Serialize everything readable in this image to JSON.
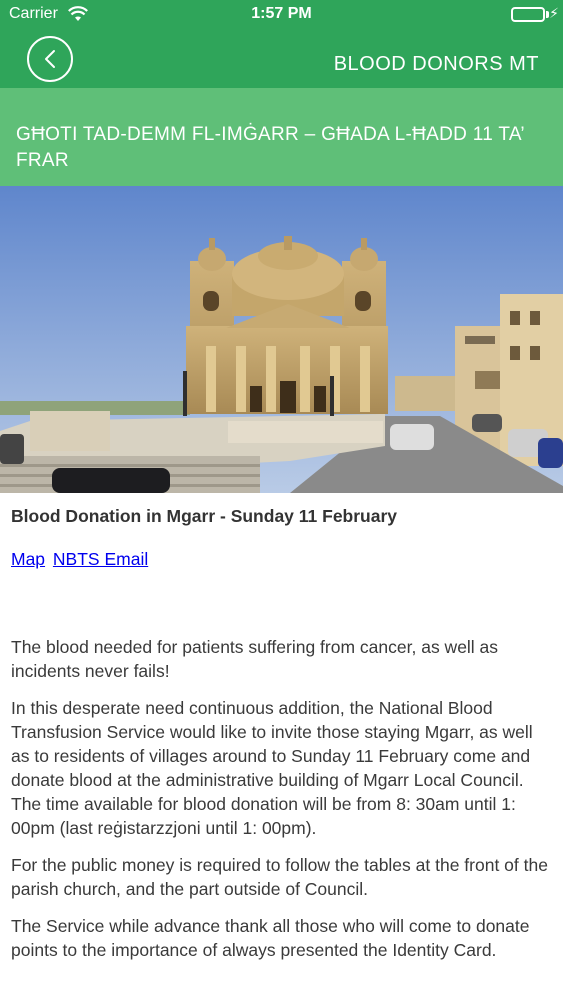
{
  "status_bar": {
    "carrier": "Carrier",
    "time": "1:57 PM",
    "battery_level": 1.0
  },
  "nav": {
    "back_icon": "chevron-left-icon",
    "title": "BLOOD DONORS MT"
  },
  "article": {
    "title": "GĦOTI TAD-DEMM FL-IMĠARR – GĦADA L-ĦADD 11 TA’ FRAR",
    "image_subject": "church",
    "headline": "Blood Donation in Mgarr - Sunday 11 February",
    "links": [
      "Map",
      "NBTS Email"
    ],
    "paragraphs": [
      "The blood needed for patients suffering from cancer, as well as incidents never fails!",
      "In this desperate need continuous addition, the National Blood Transfusion Service would like to invite those staying Mgarr, as well as to residents of villages around to Sunday 11 February come and donate blood at the administrative building of Mgarr Local Council. The time available for blood donation will be from 8: 30am until 1: 00pm (last reġistarzzjoni until 1: 00pm).",
      "For the public money is required to follow the tables at the front of the parish church, and the part outside of Council.",
      "The Service while advance thank all those who will come to donate points to the importance of always presented the Identity Card."
    ]
  },
  "colors": {
    "header_green": "#2fa55a",
    "banner_green": "#5fbf78",
    "link_blue": "#0000ee"
  }
}
